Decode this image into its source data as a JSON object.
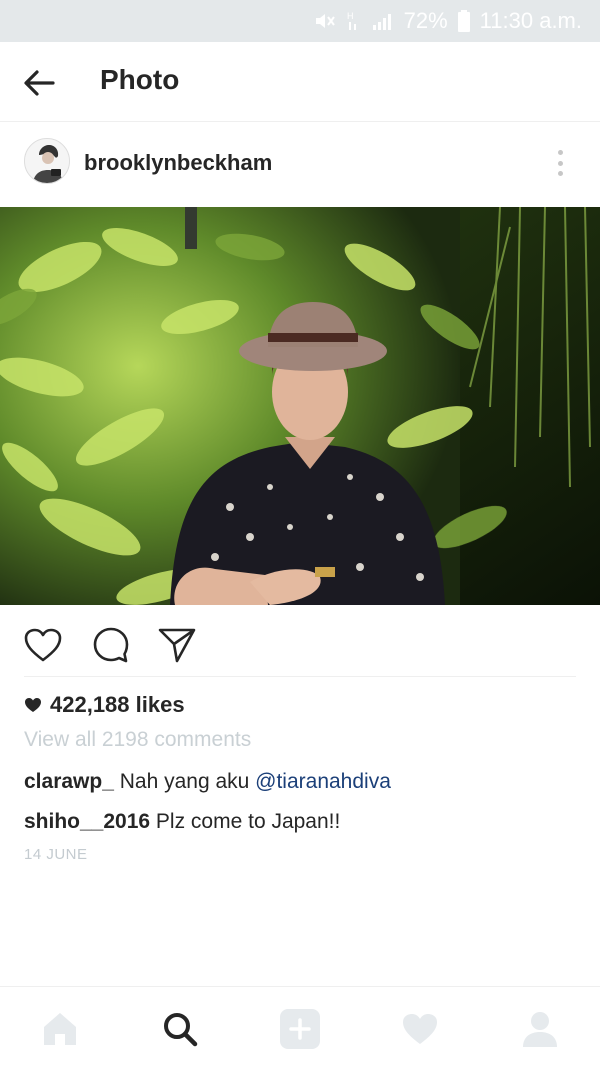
{
  "status_bar": {
    "battery": "72%",
    "time": "11:30 a.m."
  },
  "topbar": {
    "title": "Photo"
  },
  "post": {
    "username": "brooklynbeckham",
    "likes": "422,188 likes",
    "view_all": "View all 2198 comments",
    "comments": [
      {
        "user": "clarawp_",
        "text": " Nah yang aku ",
        "mention": "@tiaranahdiva"
      },
      {
        "user": "shiho__2016",
        "text": " Plz come to Japan!!",
        "mention": ""
      }
    ],
    "date": "14 JUNE"
  },
  "icons": {
    "back": "back-arrow-icon",
    "more": "more-options-icon",
    "like": "heart-icon",
    "comment": "comment-icon",
    "share": "send-icon",
    "nav": [
      "home-icon",
      "search-icon",
      "add-icon",
      "activity-heart-icon",
      "profile-icon"
    ]
  },
  "colors": {
    "status_bar_bg": "#e4e8ea",
    "mention": "#1b3f78",
    "muted_text": "#c9d0d4",
    "nav_active": "#262626",
    "nav_inactive": "#e6eaed"
  }
}
